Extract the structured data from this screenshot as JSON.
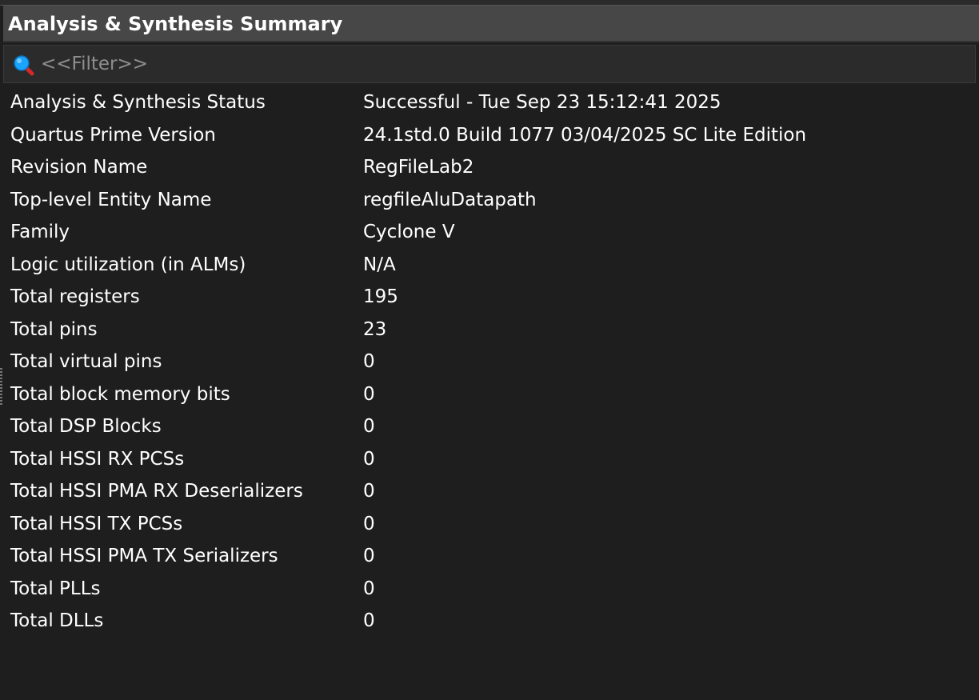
{
  "panel": {
    "title": "Analysis & Synthesis Summary"
  },
  "filter": {
    "placeholder": "<<Filter>>",
    "icon": "search-icon"
  },
  "summary": {
    "rows": [
      {
        "label": "Analysis & Synthesis Status",
        "value": "Successful - Tue Sep 23 15:12:41 2025"
      },
      {
        "label": "Quartus Prime Version",
        "value": "24.1std.0 Build 1077 03/04/2025 SC Lite Edition"
      },
      {
        "label": "Revision Name",
        "value": "RegFileLab2"
      },
      {
        "label": "Top-level Entity Name",
        "value": "regfileAluDatapath"
      },
      {
        "label": "Family",
        "value": "Cyclone V"
      },
      {
        "label": "Logic utilization (in ALMs)",
        "value": "N/A"
      },
      {
        "label": "Total registers",
        "value": "195"
      },
      {
        "label": "Total pins",
        "value": "23"
      },
      {
        "label": "Total virtual pins",
        "value": "0"
      },
      {
        "label": "Total block memory bits",
        "value": "0"
      },
      {
        "label": "Total DSP Blocks",
        "value": "0"
      },
      {
        "label": "Total HSSI RX PCSs",
        "value": "0"
      },
      {
        "label": "Total HSSI PMA RX Deserializers",
        "value": "0"
      },
      {
        "label": "Total HSSI TX PCSs",
        "value": "0"
      },
      {
        "label": "Total HSSI PMA TX Serializers",
        "value": "0"
      },
      {
        "label": "Total PLLs",
        "value": "0"
      },
      {
        "label": "Total DLLs",
        "value": "0"
      }
    ]
  },
  "colors": {
    "background": "#1e1e1e",
    "title_bar": "#474747",
    "text": "#ffffff",
    "placeholder": "#8e8e8e",
    "search_icon_fill": "#1aa3ff",
    "search_icon_handle": "#d62828"
  }
}
